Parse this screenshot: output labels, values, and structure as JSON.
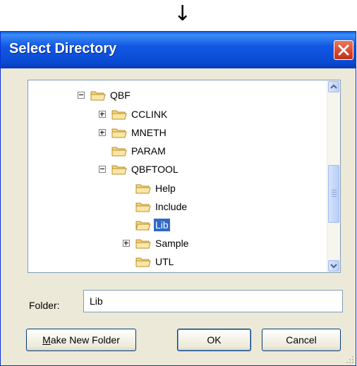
{
  "arrow": "↓",
  "dialog": {
    "title": "Select Directory",
    "tree": {
      "items": [
        {
          "label": "QBF",
          "expander": "minus"
        },
        {
          "label": "CCLINK",
          "expander": "plus"
        },
        {
          "label": "MNETH",
          "expander": "plus"
        },
        {
          "label": "PARAM",
          "expander": "none"
        },
        {
          "label": "QBFTOOL",
          "expander": "minus"
        },
        {
          "label": "Help",
          "expander": "none"
        },
        {
          "label": "Include",
          "expander": "none"
        },
        {
          "label": "Lib",
          "expander": "none",
          "selected": true
        },
        {
          "label": "Sample",
          "expander": "plus"
        },
        {
          "label": "UTL",
          "expander": "none"
        }
      ]
    },
    "folder": {
      "label": "Folder:",
      "value": "Lib"
    },
    "buttons": {
      "make_new_folder": {
        "mnemonic": "M",
        "rest": "ake New Folder"
      },
      "ok": "OK",
      "cancel": "Cancel"
    }
  },
  "colors": {
    "titlebar": "#0a4ad1",
    "selection": "#316ac5",
    "dialog_bg": "#ece9d8",
    "close": "#d9452b"
  }
}
